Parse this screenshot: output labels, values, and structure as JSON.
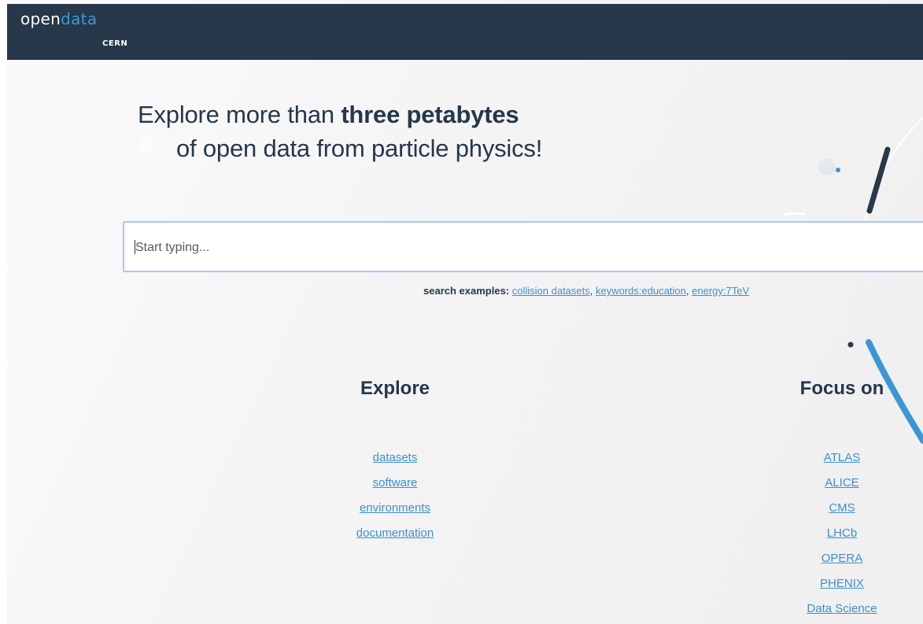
{
  "header": {
    "logo_open": "open",
    "logo_data": "data",
    "logo_cern": "CERN",
    "background_color": "#263849"
  },
  "hero": {
    "line1_prefix": "Explore more than ",
    "line1_bold": "three petabytes",
    "line2": "of open data from particle physics!"
  },
  "search": {
    "placeholder": "Start typing...",
    "value": "",
    "examples_label": "search examples:",
    "examples": [
      "collision datasets",
      "keywords:education",
      "energy:7TeV"
    ]
  },
  "explore": {
    "heading": "Explore",
    "links": [
      "datasets",
      "software",
      "environments",
      "documentation"
    ]
  },
  "focus": {
    "heading": "Focus on",
    "links": [
      "ATLAS",
      "ALICE",
      "CMS",
      "LHCb",
      "OPERA",
      "PHENIX",
      "Data Science"
    ]
  },
  "colors": {
    "accent": "#3c96d6",
    "link": "#3c8fd0",
    "text_dark": "#25374a"
  }
}
